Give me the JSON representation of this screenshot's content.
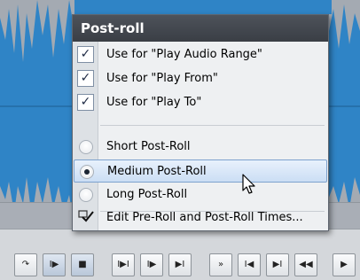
{
  "menu": {
    "title": "Post-roll",
    "items": [
      {
        "label": "Use for \"Play Audio Range\"",
        "type": "check",
        "checked": true
      },
      {
        "label": "Use for \"Play From\"",
        "type": "check",
        "checked": true
      },
      {
        "label": "Use for \"Play To\"",
        "type": "check",
        "checked": true
      },
      {
        "label": "Short Post-Roll",
        "type": "radio",
        "selected": false
      },
      {
        "label": "Medium Post-Roll",
        "type": "radio",
        "selected": true
      },
      {
        "label": "Long Post-Roll",
        "type": "radio",
        "selected": false
      },
      {
        "label": "Edit Pre-Roll and Post-Roll Times...",
        "type": "command",
        "icon": "edit-check-icon"
      }
    ],
    "checkmark": "✓"
  },
  "transport": {
    "buttons": [
      {
        "name": "loop-icon",
        "glyph": "↷"
      },
      {
        "name": "play-pre-roll-icon",
        "glyph": "I▶"
      },
      {
        "name": "play-post-roll-icon",
        "glyph": "■"
      },
      {
        "name": "play-from-start-icon",
        "glyph": "I▶I"
      },
      {
        "name": "play-from-icon",
        "glyph": "I▶"
      },
      {
        "name": "play-to-icon",
        "glyph": "▶I"
      },
      {
        "name": "fast-forward-icon",
        "glyph": "»"
      },
      {
        "name": "go-to-start-icon",
        "glyph": "I◀"
      },
      {
        "name": "go-to-end-icon",
        "glyph": "▶I"
      },
      {
        "name": "rewind-icon",
        "glyph": "◀◀"
      },
      {
        "name": "play-icon",
        "glyph": "▶"
      }
    ]
  },
  "colors": {
    "waveform": "#2f84c6",
    "menu_title_bg": "#42464d",
    "highlight": "#cbdef4"
  }
}
